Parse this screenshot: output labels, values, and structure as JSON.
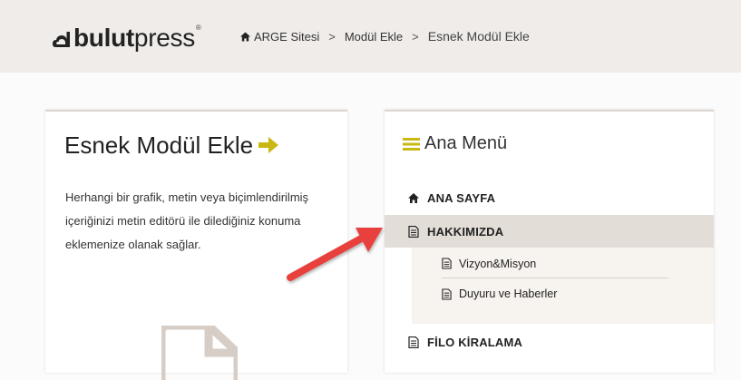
{
  "header": {
    "logo": {
      "bold": "bulut",
      "light": "press",
      "reg": "®"
    },
    "breadcrumb": {
      "home_icon": "home-icon",
      "items": [
        "ARGE Sitesi",
        "Modül Ekle",
        "Esnek Modül Ekle"
      ],
      "separator": ">"
    }
  },
  "module_card": {
    "title": "Esnek Modül Ekle",
    "title_icon": "arrow-right-icon",
    "description": "Herhangi bir grafik, metin veya biçimlendirilmiş içeriğinizi metin editörü ile dilediğiniz konuma eklemenize olanak sağlar.",
    "preview_icon": "document-icon"
  },
  "menu_card": {
    "title": "Ana Menü",
    "title_icon": "bars-icon",
    "items": [
      {
        "label": "ANA SAYFA",
        "icon": "home-icon"
      },
      {
        "label": "HAKKIMIZDA",
        "icon": "file-icon",
        "active": true
      },
      {
        "label": "FİLO KİRALAMA",
        "icon": "file-icon"
      }
    ],
    "submenu": [
      {
        "label": "Vizyon&Misyon",
        "icon": "file-icon"
      },
      {
        "label": "Duyuru ve Haberler",
        "icon": "file-icon"
      }
    ]
  },
  "colors": {
    "header_bg": "#f0ecea",
    "accent_yellow": "#c9b814",
    "active_item_bg": "#e3ddd8",
    "submenu_bg": "#f7f3ef",
    "pointer_arrow": "#e8413c"
  }
}
